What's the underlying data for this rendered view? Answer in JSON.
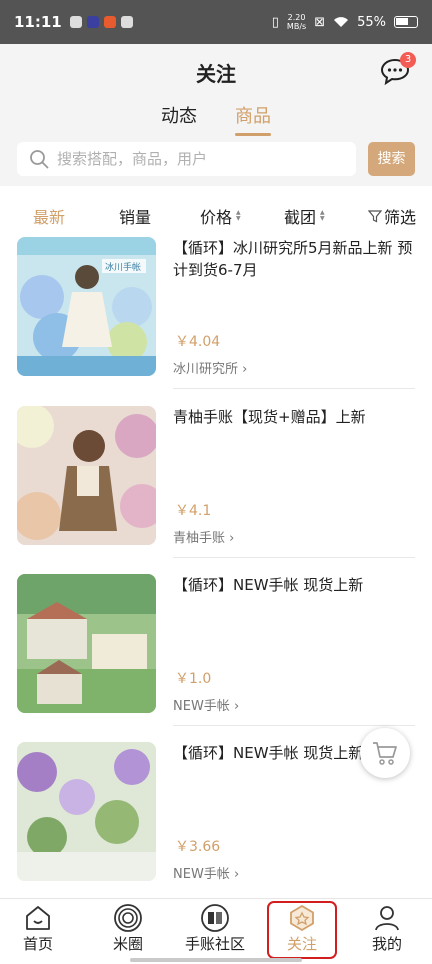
{
  "status_bar": {
    "time": "11:11",
    "net_speed_value": "2.20",
    "net_speed_unit": "MB/s",
    "battery": "55%"
  },
  "header": {
    "title": "关注",
    "message_badge": "3"
  },
  "tabs": [
    {
      "label": "动态",
      "active": false
    },
    {
      "label": "商品",
      "active": true
    }
  ],
  "search": {
    "placeholder": "搜索搭配，商品，用户",
    "button_label": "搜索"
  },
  "filters": [
    {
      "label": "最新",
      "active": true
    },
    {
      "label": "销量"
    },
    {
      "label": "价格"
    },
    {
      "label": "截团"
    },
    {
      "label": "筛选"
    }
  ],
  "products": [
    {
      "title": "【循环】冰川研究所5月新品上新 预计到货6-7月",
      "price": "￥4.04",
      "shop": "冰川研究所",
      "thumb_text": "冰川手帐"
    },
    {
      "title": "青柚手账【现货+赠品】上新",
      "price": "￥4.1",
      "shop": "青柚手账"
    },
    {
      "title": "【循环】NEW手帐 现货上新",
      "price": "￥1.0",
      "shop": "NEW手帐"
    },
    {
      "title": "【循环】NEW手帐 现货上新",
      "price": "￥3.66",
      "shop": "NEW手帐"
    }
  ],
  "bottom_nav": [
    {
      "label": "首页",
      "icon": "home-icon"
    },
    {
      "label": "米圈",
      "icon": "circle-icon"
    },
    {
      "label": "手账社区",
      "icon": "community-icon"
    },
    {
      "label": "关注",
      "icon": "follow-icon",
      "active": true
    },
    {
      "label": "我的",
      "icon": "user-icon"
    }
  ],
  "colors": {
    "accent": "#d1a06a",
    "search_button": "#d4a87a",
    "badge": "#f25c54",
    "header_bg": "#f4f4f4",
    "status_bar_bg": "#545454"
  }
}
